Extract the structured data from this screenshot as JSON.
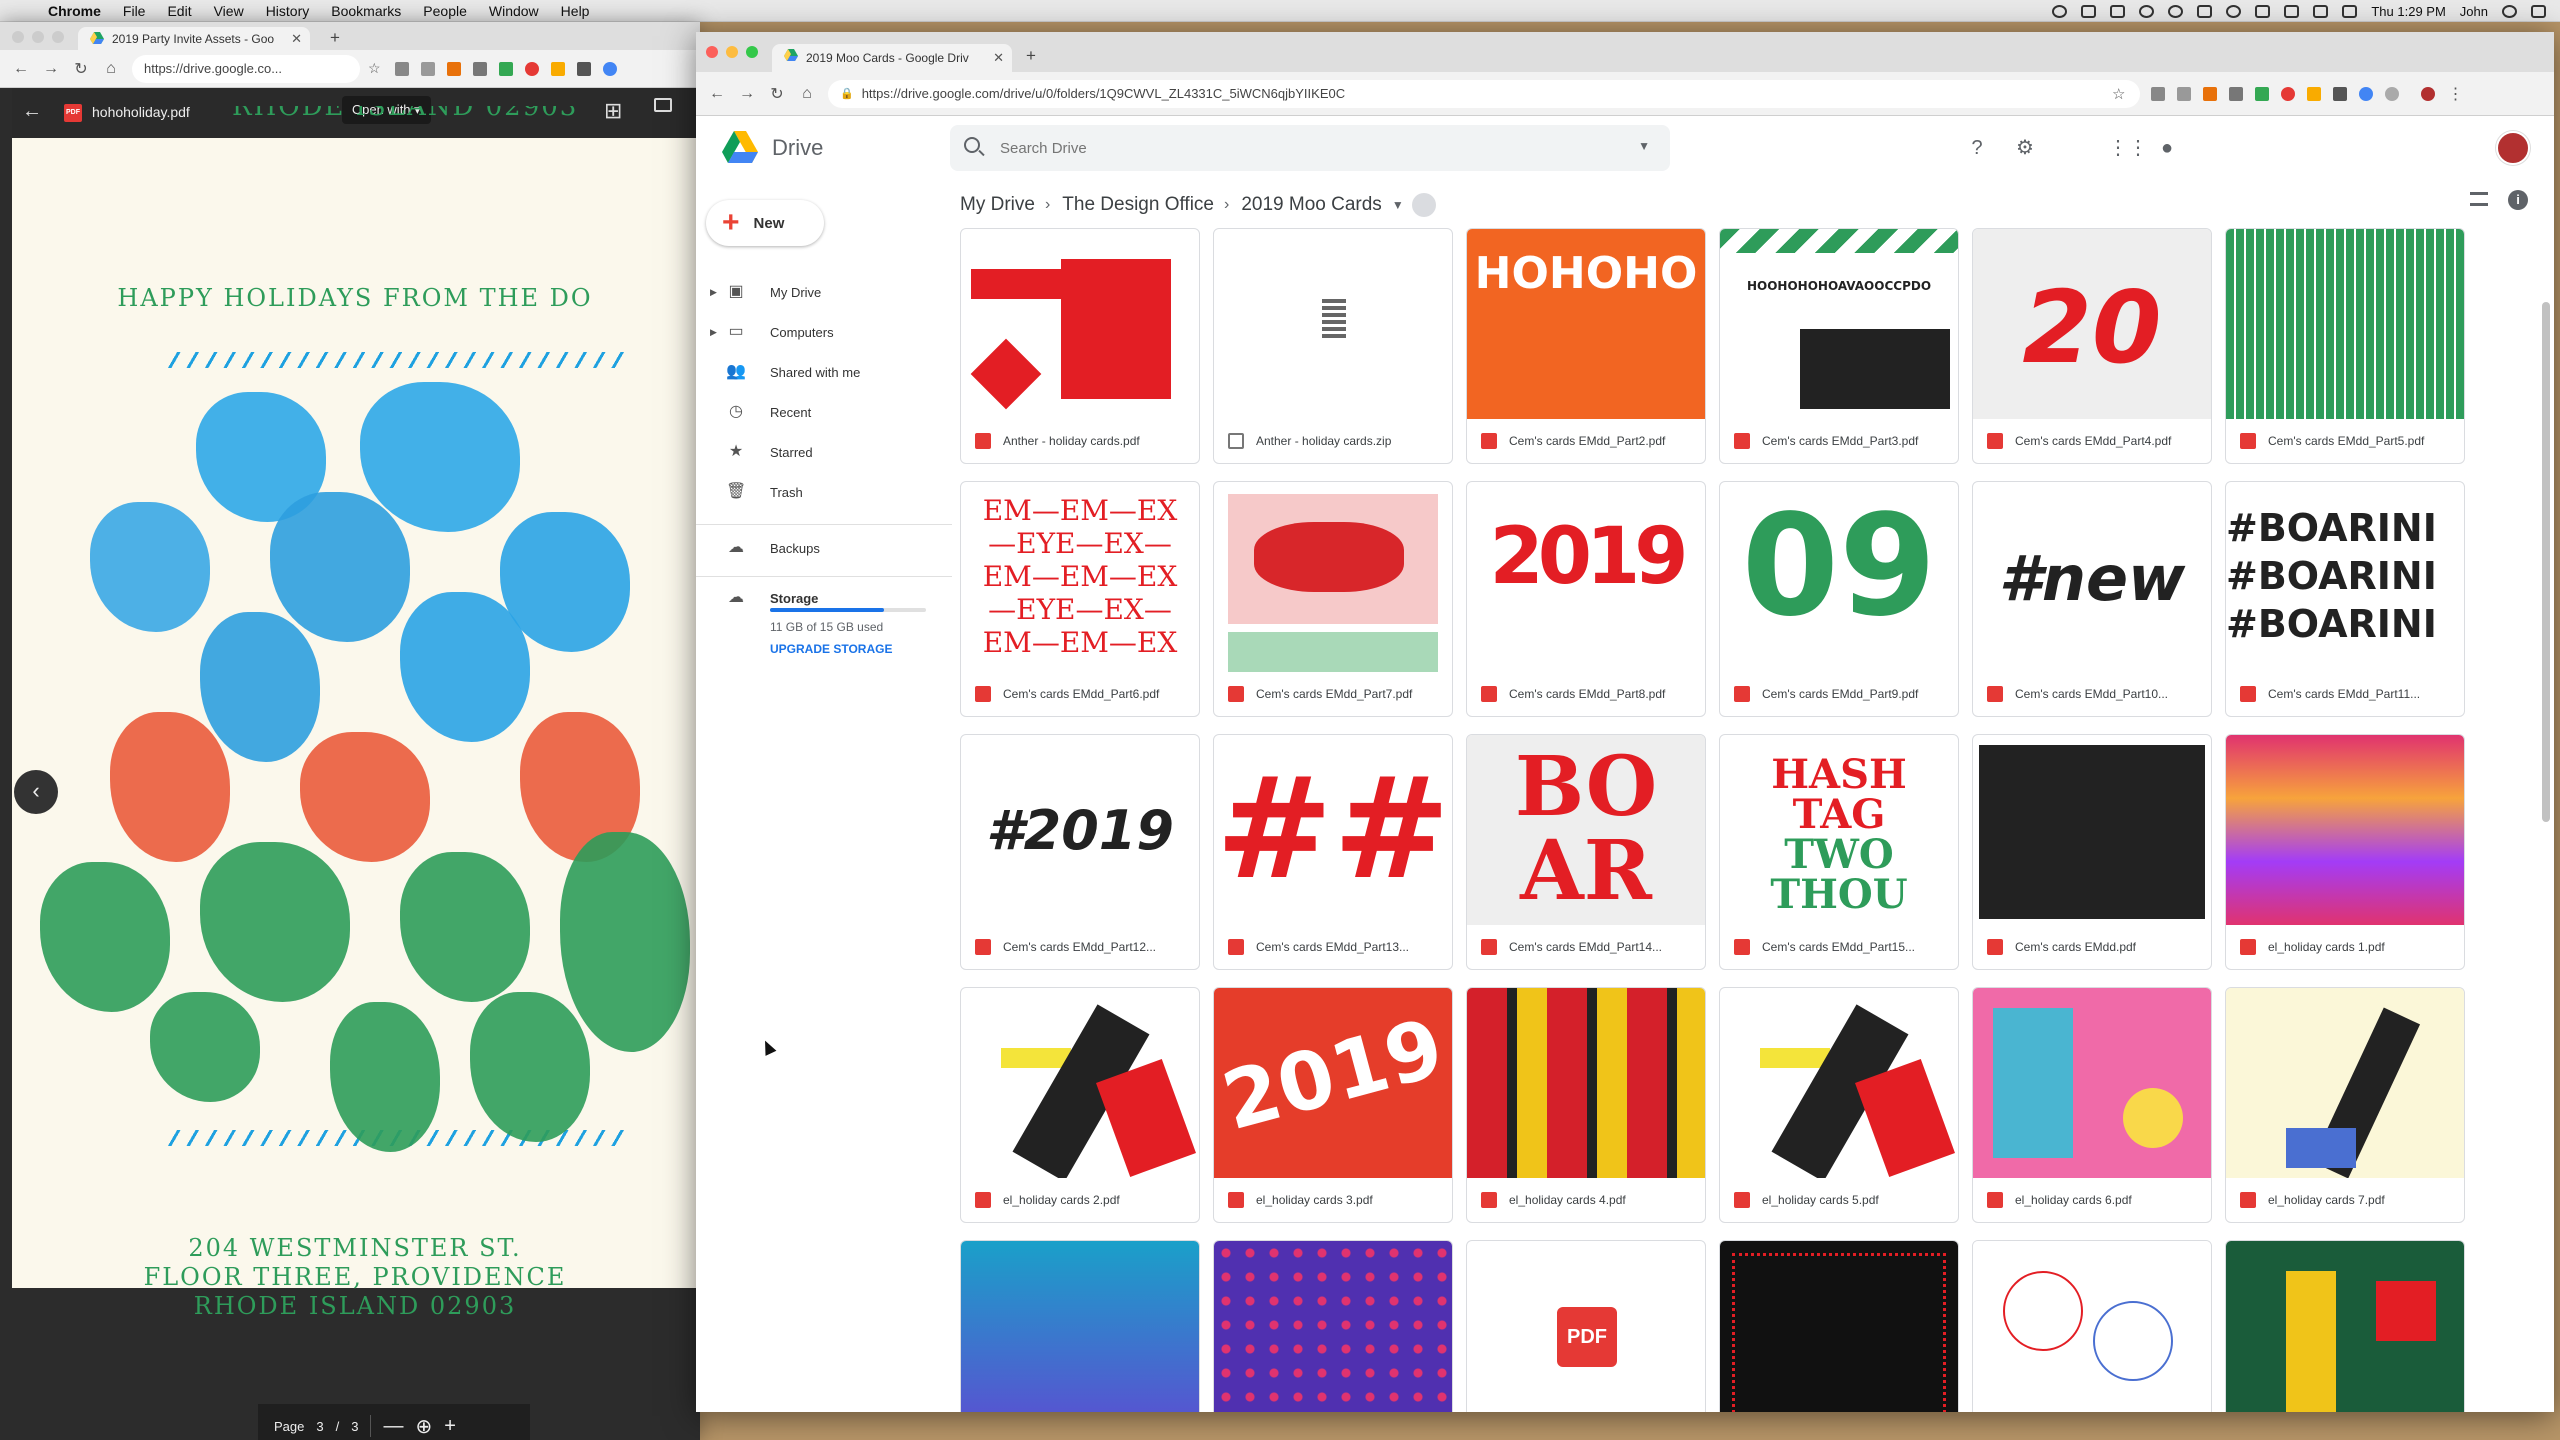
{
  "menubar": {
    "app": "Chrome",
    "items": [
      "File",
      "Edit",
      "View",
      "History",
      "Bookmarks",
      "People",
      "Window",
      "Help"
    ],
    "clock": "Thu 1:29 PM",
    "user": "John"
  },
  "left_window": {
    "tab_title": "2019 Party Invite Assets - Goo",
    "url": "https://drive.google.co...",
    "file_name": "hohoholiday.pdf",
    "open_with": "Open with",
    "card": {
      "top_fragment": "RHODE ISLAND 02903",
      "greeting": "HAPPY HOLIDAYS FROM THE DO",
      "address_line1": "204 WESTMINSTER ST.",
      "address_line2": "FLOOR THREE, PROVIDENCE",
      "address_line3": "RHODE ISLAND 02903"
    },
    "page_label": "Page",
    "page_current": "3",
    "page_sep": "/",
    "page_total": "3"
  },
  "right_window": {
    "tab_title": "2019 Moo Cards - Google Driv",
    "url": "https://drive.google.com/drive/u/0/folders/1Q9CWVL_ZL4331C_5iWCN6qjbYIIKE0C",
    "app_name": "Drive",
    "search_placeholder": "Search Drive",
    "new_label": "New",
    "sidebar": [
      {
        "label": "My Drive",
        "icon": "my-drive-icon",
        "expandable": true
      },
      {
        "label": "Computers",
        "icon": "computers-icon",
        "expandable": true
      },
      {
        "label": "Shared with me",
        "icon": "shared-icon",
        "expandable": false
      },
      {
        "label": "Recent",
        "icon": "clock-icon",
        "expandable": false
      },
      {
        "label": "Starred",
        "icon": "star-icon",
        "expandable": false
      },
      {
        "label": "Trash",
        "icon": "trash-icon",
        "expandable": false
      },
      {
        "label": "Backups",
        "icon": "cloud-icon",
        "expandable": false
      },
      {
        "label": "Storage",
        "icon": "cloud-outline-icon",
        "expandable": false
      }
    ],
    "storage": {
      "used": "11 GB of 15 GB used",
      "upgrade": "UPGRADE STORAGE",
      "used_fraction": 0.73
    },
    "breadcrumb": [
      "My Drive",
      "The Design Office",
      "2019 Moo Cards"
    ],
    "files": [
      {
        "name": "Anther - holiday cards.pdf",
        "type": "pdf",
        "thumb": "anther"
      },
      {
        "name": "Anther - holiday cards.zip",
        "type": "zip",
        "thumb": "zip"
      },
      {
        "name": "Cem's cards EMdd_Part2.pdf",
        "type": "pdf",
        "thumb": "hoho"
      },
      {
        "name": "Cem's cards EMdd_Part3.pdf",
        "type": "pdf",
        "thumb": "web"
      },
      {
        "name": "Cem's cards EMdd_Part4.pdf",
        "type": "pdf",
        "thumb": "twenty"
      },
      {
        "name": "Cem's cards EMdd_Part5.pdf",
        "type": "pdf",
        "thumb": "trees"
      },
      {
        "name": "Cem's cards EMdd_Part6.pdf",
        "type": "pdf",
        "thumb": "emeye"
      },
      {
        "name": "Cem's cards EMdd_Part7.pdf",
        "type": "pdf",
        "thumb": "boar"
      },
      {
        "name": "Cem's cards EMdd_Part8.pdf",
        "type": "pdf",
        "thumb": "n2019"
      },
      {
        "name": "Cem's cards EMdd_Part9.pdf",
        "type": "pdf",
        "thumb": "green"
      },
      {
        "name": "Cem's cards EMdd_Part10...",
        "type": "pdf",
        "thumb": "new"
      },
      {
        "name": "Cem's cards EMdd_Part11...",
        "type": "pdf",
        "thumb": "boaring"
      },
      {
        "name": "Cem's cards EMdd_Part12...",
        "type": "pdf",
        "thumb": "h2019"
      },
      {
        "name": "Cem's cards EMdd_Part13...",
        "type": "pdf",
        "thumb": "hashes"
      },
      {
        "name": "Cem's cards EMdd_Part14...",
        "type": "pdf",
        "thumb": "boarred"
      },
      {
        "name": "Cem's cards EMdd_Part15...",
        "type": "pdf",
        "thumb": "hashtag"
      },
      {
        "name": "Cem's cards EMdd.pdf",
        "type": "pdf",
        "thumb": "black"
      },
      {
        "name": "el_holiday cards 1.pdf",
        "type": "pdf",
        "thumb": "wave"
      },
      {
        "name": "el_holiday cards 2.pdf",
        "type": "pdf",
        "thumb": "collage"
      },
      {
        "name": "el_holiday cards 3.pdf",
        "type": "pdf",
        "thumb": "red2019"
      },
      {
        "name": "el_holiday cards 4.pdf",
        "type": "pdf",
        "thumb": "grid"
      },
      {
        "name": "el_holiday cards 5.pdf",
        "type": "pdf",
        "thumb": "collage"
      },
      {
        "name": "el_holiday cards 6.pdf",
        "type": "pdf",
        "thumb": "pink"
      },
      {
        "name": "el_holiday cards 7.pdf",
        "type": "pdf",
        "thumb": "abstract"
      },
      {
        "name": "",
        "type": "pdf",
        "thumb": "bluegrad"
      },
      {
        "name": "",
        "type": "pdf",
        "thumb": "purple"
      },
      {
        "name": "",
        "type": "pdf",
        "thumb": "pdficon"
      },
      {
        "name": "",
        "type": "pdf",
        "thumb": "blackred"
      },
      {
        "name": "",
        "type": "pdf",
        "thumb": "lines"
      },
      {
        "name": "",
        "type": "pdf",
        "thumb": "map"
      }
    ],
    "pdf_thumb_label": "PDF",
    "thumb_text": {
      "hoho": "HOHOHO",
      "web": "HOOHOHOHOAVAOOCCPDO",
      "twenty": "20",
      "emeye": "EM—EM—EX",
      "emeye2": "—EYE—EX—",
      "n2019": "2019",
      "green": "09",
      "new": "#new",
      "boaring": "#BOARINI",
      "h2019": "#2019",
      "hashes": "##",
      "boar1": "BO",
      "boar2": "AR",
      "hashtag1": "HASH",
      "hashtag2": "TAG",
      "hashtag3": "TWO",
      "hashtag4": "THOU",
      "red2019": "2019"
    }
  }
}
